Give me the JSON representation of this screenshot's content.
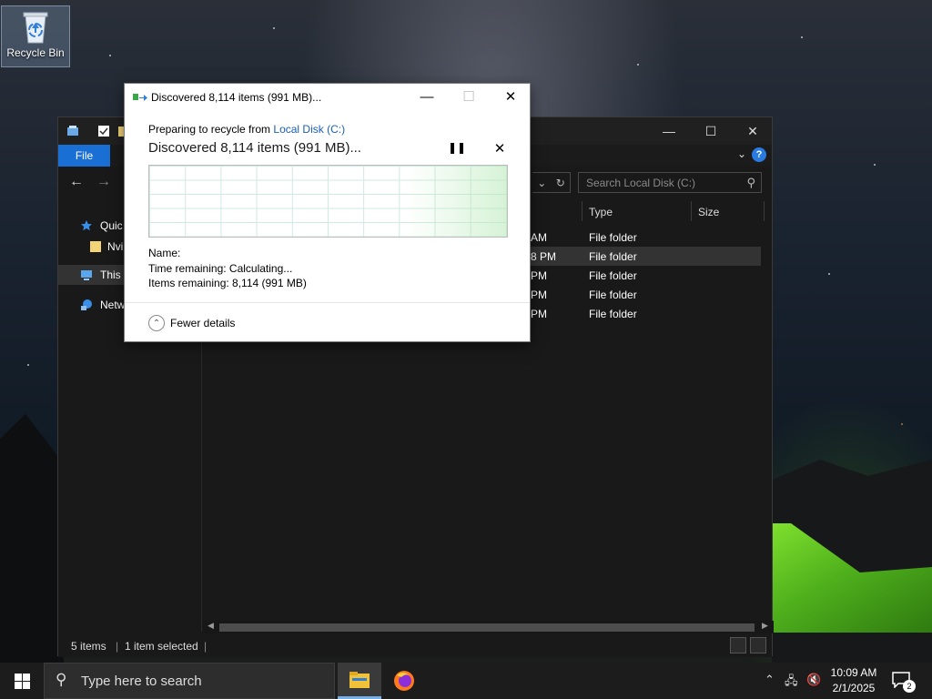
{
  "desktop": {
    "recycle_bin_label": "Recycle Bin"
  },
  "explorer": {
    "file_tab": "File",
    "help": "?",
    "search_placeholder": "Search Local Disk (C:)",
    "nav": {
      "quick_access": "Quic",
      "nvidia": "Nvi",
      "this_pc": "This",
      "network": "Netw"
    },
    "columns": {
      "type": "Type",
      "size": "Size"
    },
    "rows": [
      {
        "date": "AM",
        "type": "File folder"
      },
      {
        "date": "8 PM",
        "type": "File folder"
      },
      {
        "date": "PM",
        "type": "File folder"
      },
      {
        "date": "PM",
        "type": "File folder"
      },
      {
        "date": "PM",
        "type": "File folder"
      }
    ],
    "status": {
      "items": "5 items",
      "selected": "1 item selected"
    }
  },
  "dialog": {
    "title": "Discovered 8,114 items (991 MB)...",
    "preparing_prefix": "Preparing to recycle from ",
    "preparing_link": "Local Disk (C:)",
    "big_status": "Discovered 8,114 items (991 MB)...",
    "name_label": "Name:",
    "time_remaining": "Time remaining:  Calculating...",
    "items_remaining": "Items remaining:  8,114 (991 MB)",
    "fewer_details": "Fewer details",
    "progress_fraction": 0.0
  },
  "taskbar": {
    "search_placeholder": "Type here to search",
    "time": "10:09 AM",
    "date": "2/1/2025",
    "notification_count": "2"
  },
  "colors": {
    "accent": "#1a6fd4",
    "link": "#1a5fb4",
    "tent_green": "#7fe02e"
  }
}
